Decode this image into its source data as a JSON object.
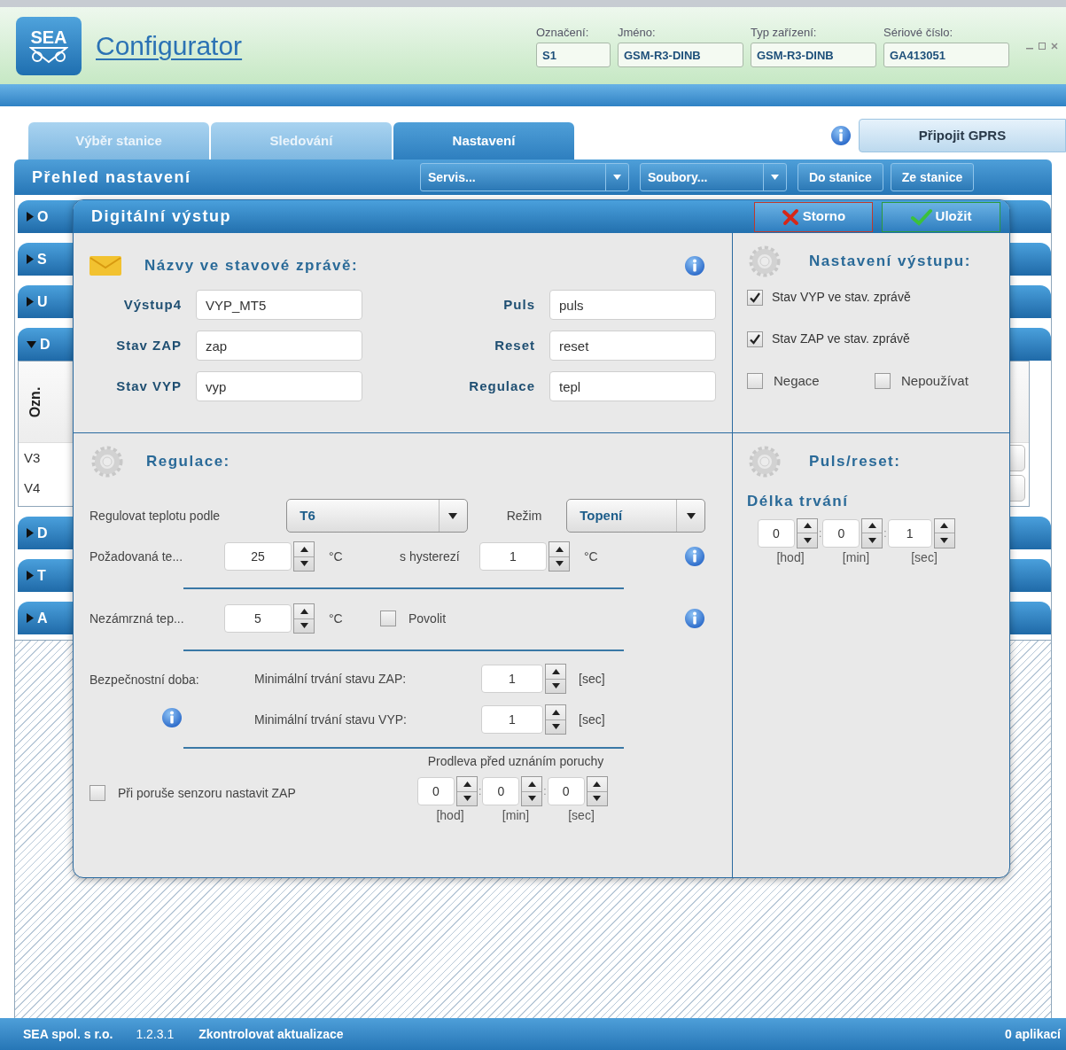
{
  "header": {
    "logo_text": "SEA",
    "title": "Configurator",
    "fields": [
      {
        "label": "Označení:",
        "value": "S1"
      },
      {
        "label": "Jméno:",
        "value": "GSM-R3-DINB"
      },
      {
        "label": "Typ zařízení:",
        "value": "GSM-R3-DINB"
      },
      {
        "label": "Sériové číslo:",
        "value": "GA413051"
      }
    ]
  },
  "tabs": [
    {
      "label": "Výběr stanice",
      "selected": false
    },
    {
      "label": "Sledování",
      "selected": false
    },
    {
      "label": "Nastavení",
      "selected": true
    }
  ],
  "gprs_button": "Připojit GPRS",
  "toolbar": {
    "title": "Přehled nastavení",
    "dropdowns": [
      "Servis...",
      "Soubory..."
    ],
    "buttons": [
      "Do stanice",
      "Ze stanice"
    ]
  },
  "accordion": [
    {
      "label": "O",
      "expanded": false
    },
    {
      "label": "S",
      "expanded": false
    },
    {
      "label": "U",
      "expanded": false
    },
    {
      "label": "D",
      "expanded": true,
      "table": {
        "column": "Ozn.",
        "rows": [
          "V3",
          "V4"
        ]
      }
    },
    {
      "label": "D",
      "expanded": false
    },
    {
      "label": "T",
      "expanded": false
    },
    {
      "label": "A",
      "expanded": false
    }
  ],
  "dialog": {
    "title": "Digitální výstup",
    "cancel": "Storno",
    "save": "Uložit",
    "names": {
      "title": "Názvy ve stavové zprávě:",
      "fields": [
        {
          "label": "Výstup4",
          "value": "VYP_MT5"
        },
        {
          "label": "Stav ZAP",
          "value": "zap"
        },
        {
          "label": "Stav VYP",
          "value": "vyp"
        },
        {
          "label": "Puls",
          "value": "puls"
        },
        {
          "label": "Reset",
          "value": "reset"
        },
        {
          "label": "Regulace",
          "value": "tepl"
        }
      ]
    },
    "output_settings": {
      "title": "Nastavení výstupu:",
      "options": [
        {
          "label": "Stav VYP ve stav. zprávě",
          "checked": true
        },
        {
          "label": "Stav ZAP ve stav. zprávě",
          "checked": true
        },
        {
          "label": "Negace",
          "checked": false
        },
        {
          "label": "Nepoužívat",
          "checked": false
        }
      ]
    },
    "regulation": {
      "title": "Regulace:",
      "source_label": "Regulovat teplotu podle",
      "source_value": "T6",
      "mode_label": "Režim",
      "mode_value": "Topení",
      "target": {
        "label": "Požadovaná te...",
        "value": "25",
        "unit": "°C"
      },
      "hysteresis": {
        "label": "s hysterezí",
        "value": "1",
        "unit": "°C"
      },
      "frost": {
        "label": "Nezámrzná tep...",
        "value": "5",
        "unit": "°C"
      },
      "enable": {
        "label": "Povolit",
        "checked": false
      },
      "safety_label": "Bezpečnostní doba:",
      "min_times": [
        {
          "label": "Minimální trvání stavu ZAP:",
          "value": "1",
          "unit": "[sec]"
        },
        {
          "label": "Minimální trvání stavu VYP:",
          "value": "1",
          "unit": "[sec]"
        }
      ],
      "sensor_fault": {
        "label": "Při poruše senzoru nastavit ZAP",
        "checked": false
      },
      "delay": {
        "title": "Prodleva před uznáním poruchy",
        "separators": [
          ":",
          ":"
        ],
        "parts": [
          {
            "value": "0",
            "unit": "[hod]"
          },
          {
            "value": "0",
            "unit": "[min]"
          },
          {
            "value": "0",
            "unit": "[sec]"
          }
        ]
      }
    },
    "pulse": {
      "title": "Puls/reset:",
      "duration_label": "Délka trvání",
      "separators": [
        ":",
        ":"
      ],
      "parts": [
        {
          "value": "0",
          "unit": "[hod]"
        },
        {
          "value": "0",
          "unit": "[min]"
        },
        {
          "value": "1",
          "unit": "[sec]"
        }
      ]
    }
  },
  "status_bar": {
    "company": "SEA spol. s r.o.",
    "version": "1.2.3.1",
    "update_link": "Zkontrolovat aktualizace",
    "apps": "0 aplikací"
  }
}
